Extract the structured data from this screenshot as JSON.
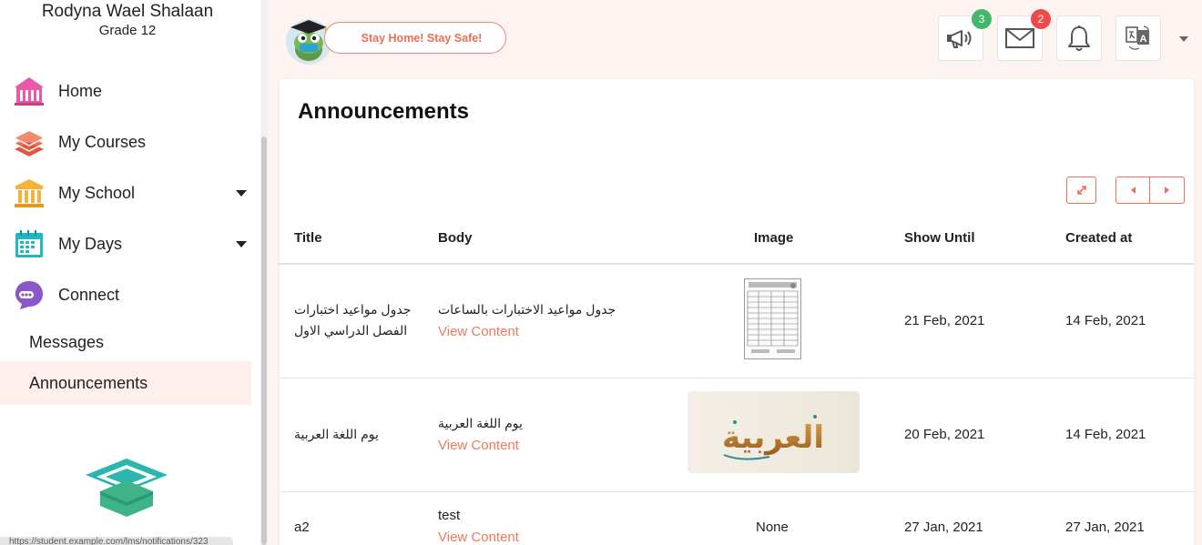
{
  "user": {
    "name": "Rodyna Wael Shalaan",
    "grade": "Grade 12"
  },
  "sidebar": {
    "items": [
      {
        "label": "Home",
        "icon": "school-building-icon",
        "color": "#e85aa8",
        "has_caret": false
      },
      {
        "label": "My Courses",
        "icon": "books-icon",
        "color": "#ef6e52",
        "has_caret": false
      },
      {
        "label": "My School",
        "icon": "institution-icon",
        "color": "#f3b23a",
        "has_caret": true
      },
      {
        "label": "My Days",
        "icon": "calendar-icon",
        "color": "#1fb8c4",
        "has_caret": true
      },
      {
        "label": "Connect",
        "icon": "chat-bubble-icon",
        "color": "#8a56c9",
        "has_caret": false
      }
    ],
    "sub_items": [
      {
        "label": "Messages",
        "active": false
      },
      {
        "label": "Announcements",
        "active": true
      }
    ],
    "status_text": "https://student.example.com/lms/notifications/323"
  },
  "topbar": {
    "banner_text": "Stay Home! Stay Safe!",
    "announcements_badge": "3",
    "messages_badge": "2"
  },
  "main": {
    "title": "Announcements",
    "columns": [
      "Title",
      "Body",
      "Image",
      "Show Until",
      "Created at"
    ],
    "rows": [
      {
        "title": "جدول مواعيد اختبارات الفصل الدراسي الاول",
        "body": "جدول مواعيد الاختبارات بالساعات",
        "link": "View Content",
        "image": "schedule-document-thumbnail",
        "show_until": "21 Feb, 2021",
        "created_at": "14 Feb, 2021"
      },
      {
        "title": "يوم اللغة العربية",
        "body": "يوم اللغة العربية",
        "link": "View Content",
        "image": "arabic-calligraphy-thumbnail",
        "image_text": "العربية",
        "show_until": "20 Feb, 2021",
        "created_at": "14 Feb, 2021"
      },
      {
        "title": "a2",
        "body": "test",
        "link": "View Content",
        "image_text": "None",
        "show_until": "27 Jan, 2021",
        "created_at": "27 Jan, 2021"
      }
    ]
  },
  "colors": {
    "accent": "#ef6e52",
    "page_bg": "#fdf3f1",
    "active_bg": "#fdefec"
  }
}
